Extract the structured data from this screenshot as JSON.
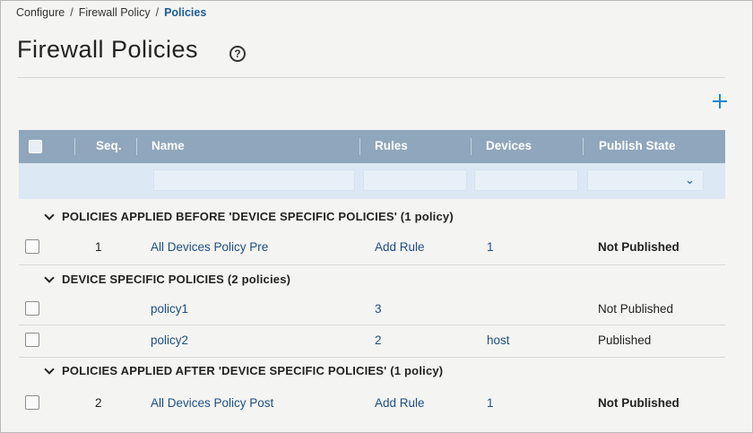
{
  "breadcrumb": {
    "items": [
      "Configure",
      "Firewall Policy",
      "Policies"
    ],
    "separator": "/"
  },
  "page": {
    "title": "Firewall Policies",
    "help_glyph": "?"
  },
  "table": {
    "columns": {
      "seq": "Seq.",
      "name": "Name",
      "rules": "Rules",
      "devices": "Devices",
      "publish_state": "Publish State"
    },
    "filter_chevron": "⌄"
  },
  "groups": [
    {
      "label": "POLICIES APPLIED BEFORE 'DEVICE SPECIFIC POLICIES' (1 policy)",
      "rows": [
        {
          "seq": "1",
          "name": "All Devices Policy Pre",
          "rules": "Add Rule",
          "devices": "1",
          "state": "Not Published"
        }
      ]
    },
    {
      "label": "DEVICE SPECIFIC POLICIES (2 policies)",
      "rows": [
        {
          "seq": "",
          "name": "policy1",
          "rules": "3",
          "devices": "",
          "state": "Not Published"
        },
        {
          "seq": "",
          "name": "policy2",
          "rules": "2",
          "devices": "host",
          "state": "Published"
        }
      ]
    },
    {
      "label": "POLICIES APPLIED AFTER 'DEVICE SPECIFIC POLICIES' (1 policy)",
      "rows": [
        {
          "seq": "2",
          "name": "All Devices Policy Post",
          "rules": "Add Rule",
          "devices": "1",
          "state": "Not Published"
        }
      ]
    }
  ],
  "colors": {
    "header_bg": "#8fa6bc",
    "filter_bg": "#dce8f3",
    "link": "#1e4f84",
    "breadcrumb_current": "#1d5d94",
    "accent_add": "#1f87c8"
  }
}
